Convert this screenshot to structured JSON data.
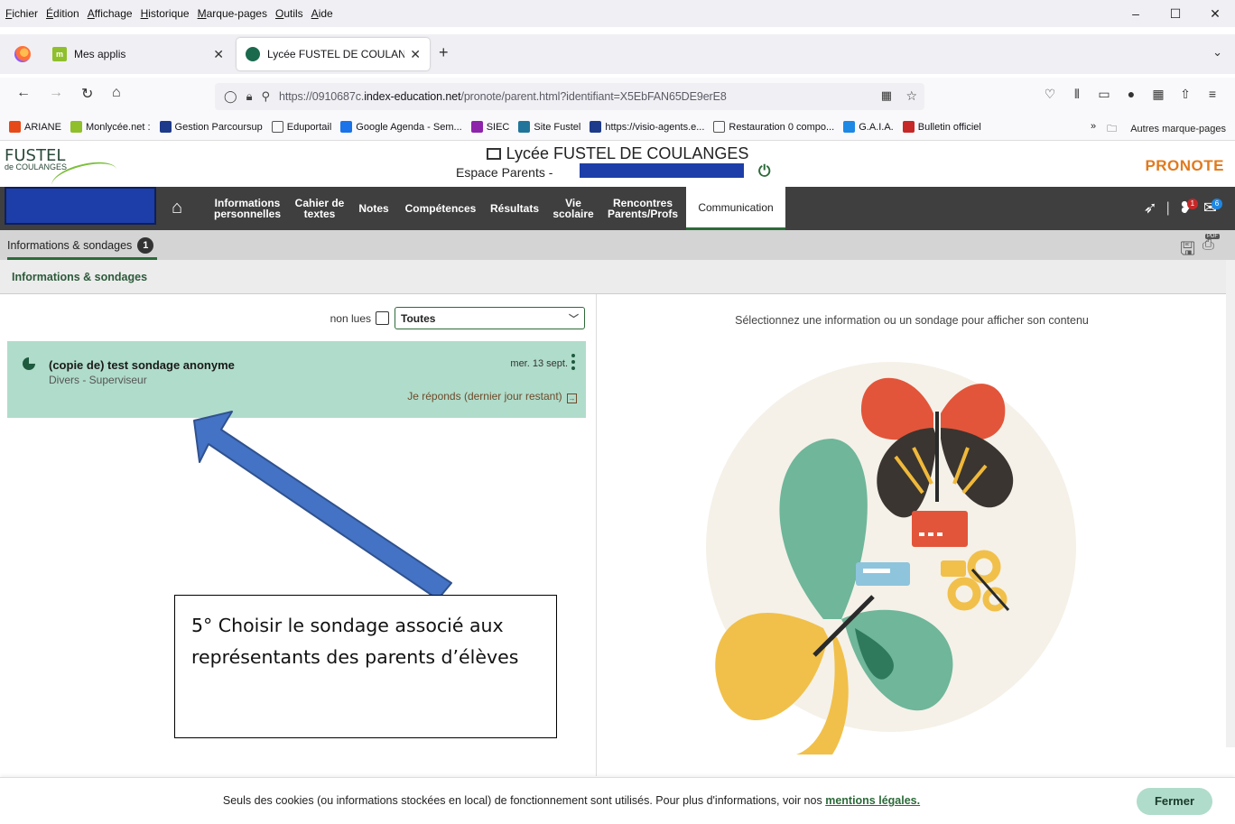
{
  "menubar": {
    "items": [
      "Fichier",
      "Édition",
      "Affichage",
      "Historique",
      "Marque-pages",
      "Outils",
      "Aide"
    ]
  },
  "tabs": [
    {
      "label": "Mes applis",
      "icon": "apps-icon"
    },
    {
      "label": "Lycée FUSTEL DE COULANGES -",
      "icon": "pronote-icon"
    }
  ],
  "address": {
    "prefix": "https://0910687c.",
    "host": "index-education.net",
    "path": "/pronote/parent.html?identifiant=X5EbFAN65DE9erE8"
  },
  "bookmarks": [
    {
      "label": "ARIANE",
      "color": "#e64a19"
    },
    {
      "label": "Monlycée.net :",
      "color": "#8fbf2a"
    },
    {
      "label": "Gestion Parcoursup",
      "color": "#1e3a8a"
    },
    {
      "label": "Eduportail",
      "color": "#f9f9fb"
    },
    {
      "label": "Google Agenda - Sem...",
      "color": "#1a73e8"
    },
    {
      "label": "SIEC",
      "color": "#8e24aa"
    },
    {
      "label": "Site Fustel",
      "color": "#21759b"
    },
    {
      "label": "https://visio-agents.e...",
      "color": "#1e3a8a"
    },
    {
      "label": "Restauration 0 compo...",
      "color": "#f9f9fb"
    },
    {
      "label": "G.A.I.A.",
      "color": "#1e88e5"
    },
    {
      "label": "Bulletin officiel",
      "color": "#c62828"
    }
  ],
  "bookmarks_more": "Autres marque-pages",
  "header": {
    "logo_big": "FUSTEL",
    "logo_small": "de COULANGES",
    "school": "Lycée FUSTEL DE COULANGES",
    "espace": "Espace Parents -",
    "brand": "PRONOTE"
  },
  "nav": {
    "items": [
      {
        "label": "Informations personnelles"
      },
      {
        "label": "Cahier de textes"
      },
      {
        "label": "Notes"
      },
      {
        "label": "Compétences"
      },
      {
        "label": "Résultats"
      },
      {
        "label": "Vie scolaire"
      },
      {
        "label": "Rencontres Parents/Profs"
      },
      {
        "label": "Communication"
      }
    ],
    "badge_messages": "1",
    "badge_other": "6"
  },
  "subtab": {
    "label": "Informations & sondages",
    "count": "1"
  },
  "section": {
    "title": "Informations & sondages"
  },
  "filter": {
    "unread_label": "non lues",
    "selected": "Toutes"
  },
  "list": {
    "items": [
      {
        "title": "(copie de) test sondage anonyme",
        "subtitle": "Divers - Superviseur",
        "date": "mer. 13 sept.",
        "action": "Je réponds (dernier jour restant)"
      }
    ]
  },
  "detail": {
    "hint": "Sélectionnez une information ou un sondage pour afficher son contenu"
  },
  "annotation": {
    "text": "5° Choisir le sondage associé aux représentants des parents d’élèves"
  },
  "cookie": {
    "text": "Seuls des cookies (ou informations stockées en local) de fonctionnement sont utilisés. Pour plus d'informations, voir nos",
    "link": "mentions légales.",
    "close": "Fermer"
  },
  "colors": {
    "accent_green": "#2c6a3a",
    "item_bg": "#b0dccb",
    "nav_bg": "#3f3f3f",
    "brand_orange": "#e07a1e",
    "redaction_blue": "#1d3ea8",
    "arrow_blue": "#4472c4"
  }
}
